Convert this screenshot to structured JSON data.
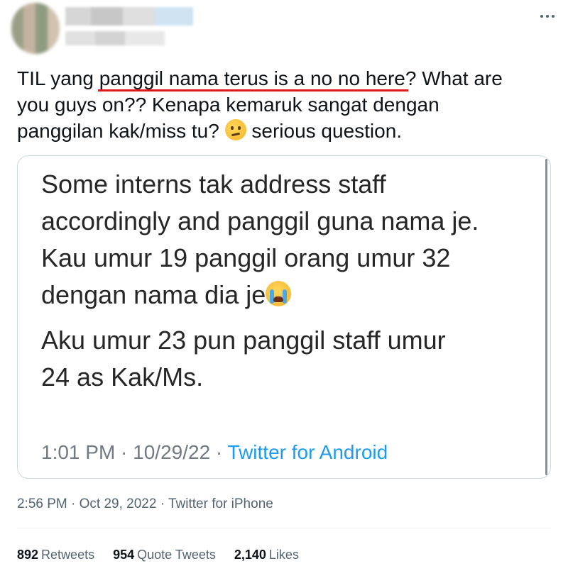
{
  "header": {
    "more_icon": "ellipsis-horizontal-icon"
  },
  "tweet": {
    "line1_prefix": "TIL yang ",
    "line1_underlined": "panggil nama terus is a no no here",
    "line1_suffix": "? What are",
    "line2": "you guys on?? Kenapa kemaruk sangat dengan",
    "line3_prefix": "panggilan kak/miss tu? ",
    "line3_emoji": "thinking-face-emoji",
    "line3_suffix": " serious question."
  },
  "quote": {
    "para1_line1": "Some interns tak address staff",
    "para1_line2": "accordingly and panggil guna nama je.",
    "para1_line3": "Kau umur 19 panggil orang umur 32",
    "para1_line4": "dengan nama dia je",
    "para1_emoji": "loudly-crying-face-emoji",
    "para2_line1": "Aku umur 23 pun panggil staff umur",
    "para2_line2": "24 as Kak/Ms.",
    "time": "1:01 PM · 10/29/22 · ",
    "app": "Twitter for Android"
  },
  "meta": {
    "timestamp": "2:56 PM · Oct 29, 2022 · Twitter for iPhone"
  },
  "stats": {
    "retweets_count": "892",
    "retweets_label": "Retweets",
    "quotes_count": "954",
    "quotes_label": "Quote Tweets",
    "likes_count": "2,140",
    "likes_label": "Likes"
  },
  "colors": {
    "underline": "#e0161a",
    "link_blue": "#1d9bf0",
    "secondary_text": "#536471"
  }
}
